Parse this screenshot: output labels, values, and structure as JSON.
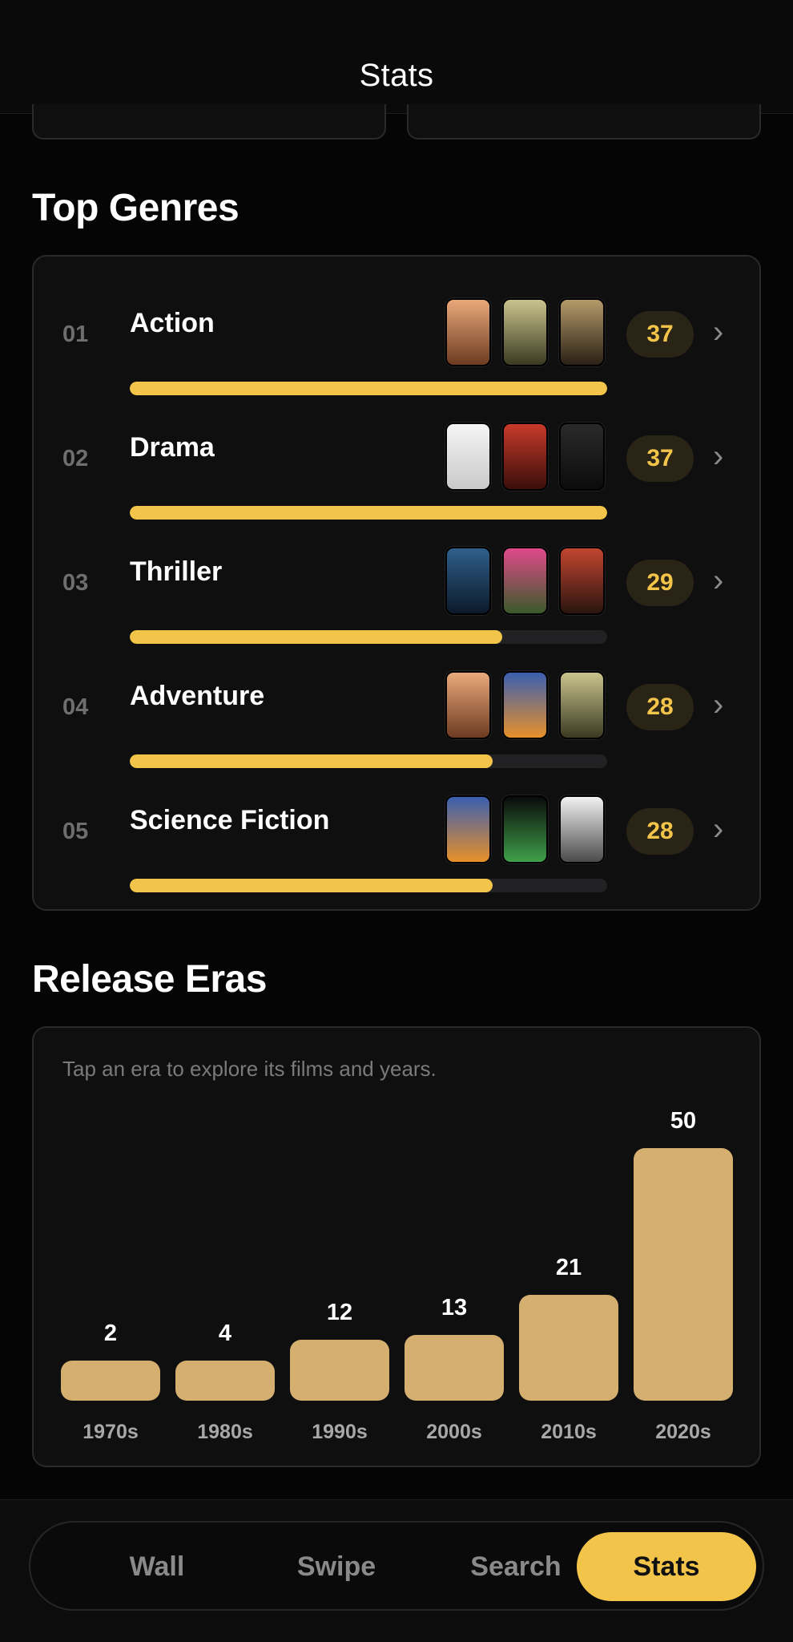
{
  "header": {
    "title": "Stats"
  },
  "top_genres": {
    "title": "Top Genres",
    "rows": [
      {
        "rank": "01",
        "name": "Action",
        "count": "37",
        "fill": 1.0,
        "posters": [
          {
            "icon": "poster-desert",
            "colors": [
              "#e9a97a",
              "#6d3b22"
            ]
          },
          {
            "icon": "poster-lotr-fellowship",
            "colors": [
              "#c9c48e",
              "#3b3a22"
            ]
          },
          {
            "icon": "poster-lotr-towers",
            "colors": [
              "#b59a6a",
              "#2a2015"
            ]
          }
        ]
      },
      {
        "rank": "02",
        "name": "Drama",
        "count": "37",
        "fill": 1.0,
        "posters": [
          {
            "icon": "poster-forrest-gump",
            "colors": [
              "#f5f5f5",
              "#c9c9c9"
            ]
          },
          {
            "icon": "poster-apocalypse-now",
            "colors": [
              "#c73a2a",
              "#3a0e0a"
            ]
          },
          {
            "icon": "poster-8-mile",
            "colors": [
              "#2a2a2a",
              "#0b0b0b"
            ]
          }
        ]
      },
      {
        "rank": "03",
        "name": "Thriller",
        "count": "29",
        "fill": 0.78,
        "posters": [
          {
            "icon": "poster-dark-knight",
            "colors": [
              "#2f5f8a",
              "#0c1a2a"
            ]
          },
          {
            "icon": "poster-fight-club",
            "colors": [
              "#e04a8a",
              "#3a5a2a"
            ]
          },
          {
            "icon": "poster-pulp-fiction",
            "colors": [
              "#c2452f",
              "#2a1510"
            ]
          }
        ]
      },
      {
        "rank": "04",
        "name": "Adventure",
        "count": "28",
        "fill": 0.76,
        "posters": [
          {
            "icon": "poster-desert",
            "colors": [
              "#e9a97a",
              "#6d3b22"
            ]
          },
          {
            "icon": "poster-back-to-the-future",
            "colors": [
              "#3a5fb0",
              "#e8902a"
            ]
          },
          {
            "icon": "poster-lotr-fellowship",
            "colors": [
              "#c9c48e",
              "#3b3a22"
            ]
          }
        ]
      },
      {
        "rank": "05",
        "name": "Science Fiction",
        "count": "28",
        "fill": 0.76,
        "posters": [
          {
            "icon": "poster-back-to-the-future",
            "colors": [
              "#3a5fb0",
              "#e8902a"
            ]
          },
          {
            "icon": "poster-alien",
            "colors": [
              "#0a0a0a",
              "#3fa04a"
            ]
          },
          {
            "icon": "poster-matrix",
            "colors": [
              "#f2f2f2",
              "#4a4a4a"
            ]
          }
        ]
      }
    ]
  },
  "release_eras": {
    "title": "Release Eras",
    "hint": "Tap an era to explore its films and years."
  },
  "chart_data": {
    "type": "bar",
    "categories": [
      "1970s",
      "1980s",
      "1990s",
      "2000s",
      "2010s",
      "2020s"
    ],
    "values": [
      2,
      4,
      12,
      13,
      21,
      50
    ],
    "value_labels": [
      "2",
      "4",
      "12",
      "13",
      "21",
      "50"
    ],
    "title": "",
    "xlabel": "",
    "ylabel": "",
    "bar_color": "#d5af70",
    "grid": false
  },
  "tabs": [
    {
      "label": "Wall",
      "active": false
    },
    {
      "label": "Swipe",
      "active": false
    },
    {
      "label": "Search",
      "active": false
    },
    {
      "label": "Stats",
      "active": true
    }
  ],
  "colors": {
    "accent": "#f3c44a",
    "background": "#050505",
    "card": "#0f0f10"
  }
}
